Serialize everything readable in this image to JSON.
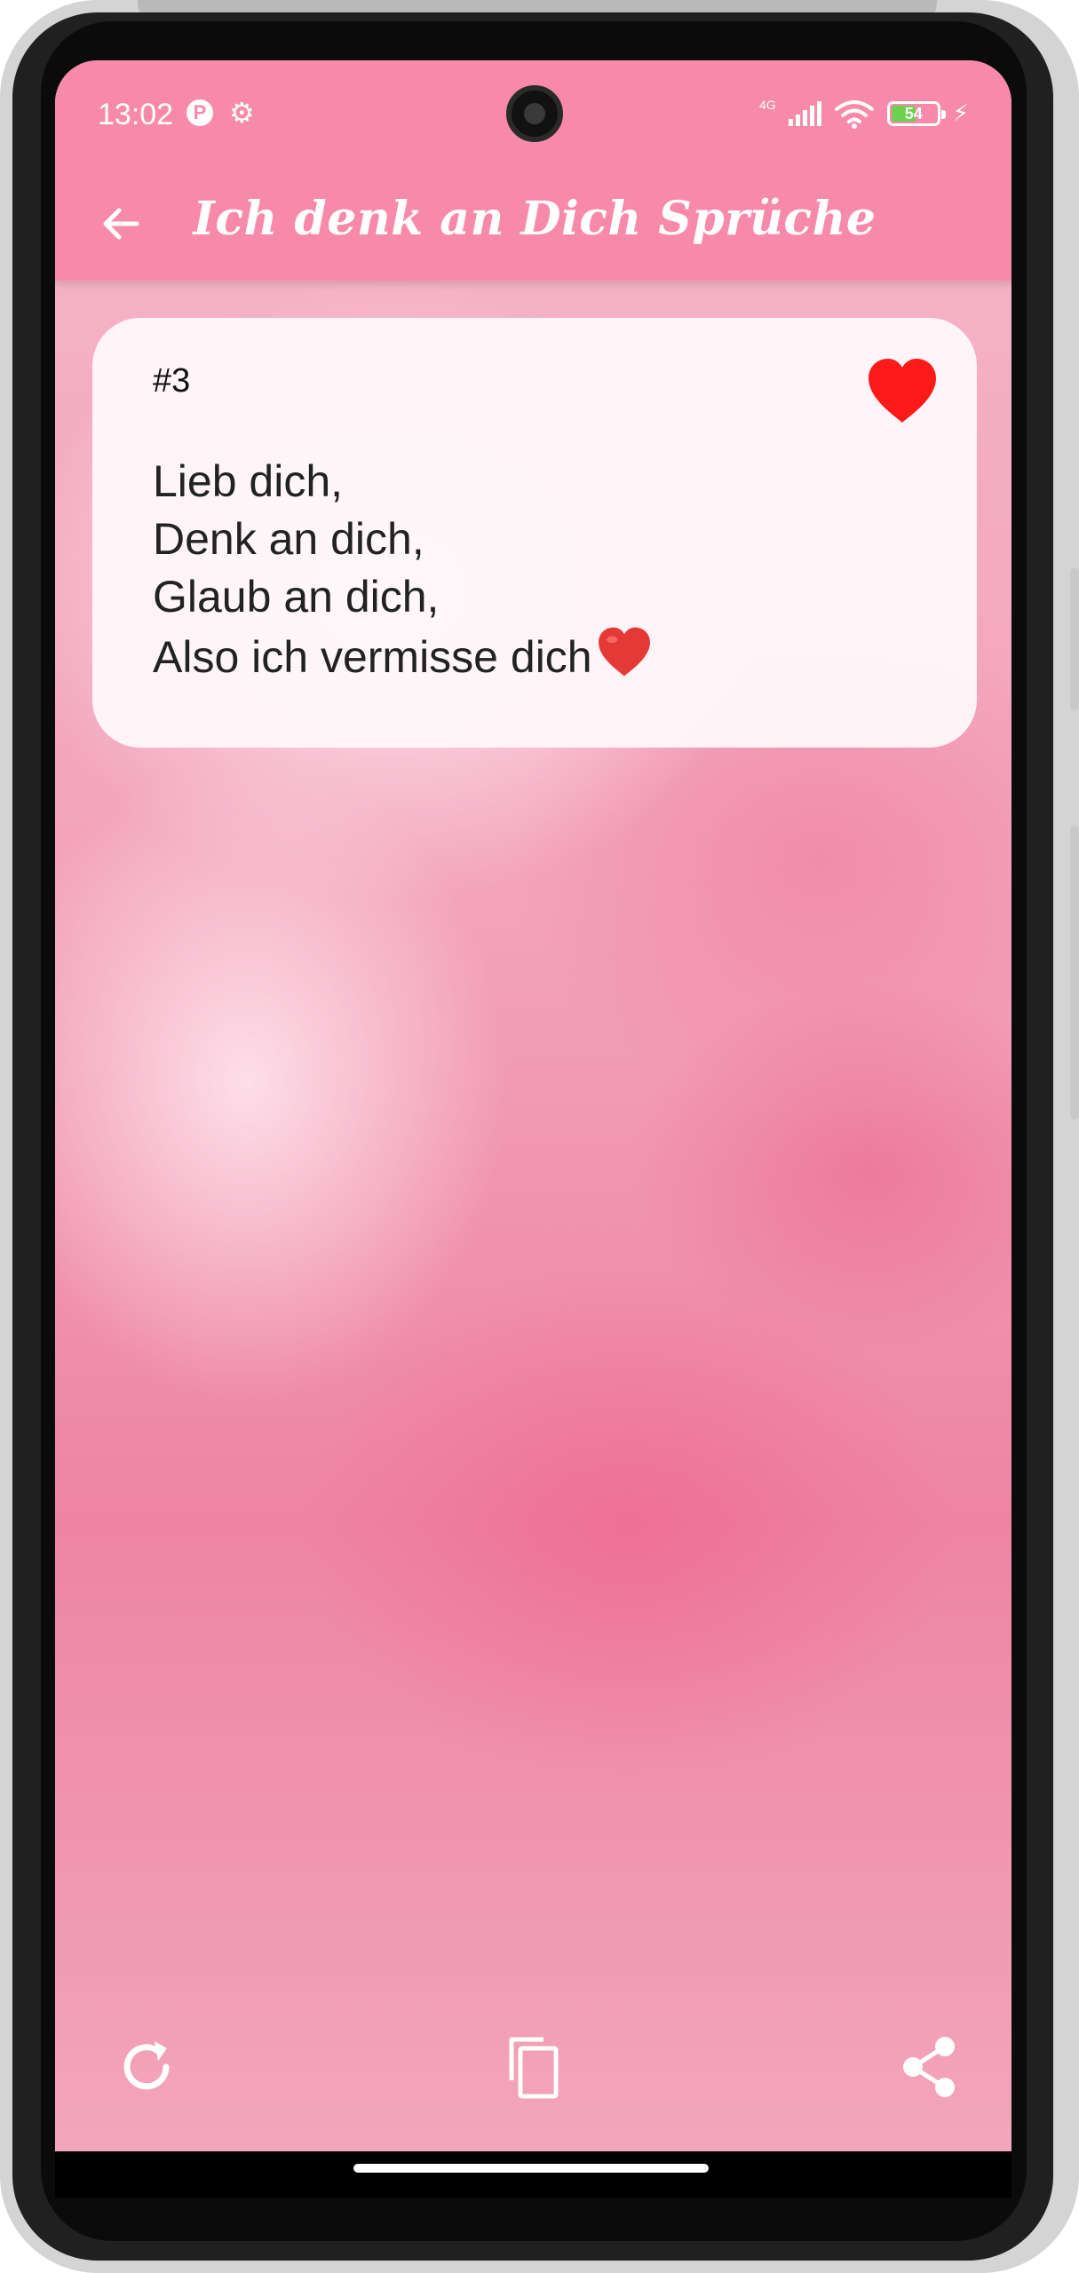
{
  "status_bar": {
    "time": "13:02",
    "network": "4G",
    "battery": "54",
    "battery_level": 0.54
  },
  "app_bar": {
    "title": "Ich denk an Dich Sprüche",
    "back_icon": "arrow-left-icon"
  },
  "quote": {
    "number": "#3",
    "lines": [
      "Lieb dich,",
      "Denk an dich,",
      "Glaub an dich,",
      "Also ich vermisse dich"
    ],
    "trailing_emoji": "red-heart-emoji",
    "favorite": true,
    "favorite_icon": "heart-icon"
  },
  "actions": {
    "refresh_icon": "refresh-icon",
    "copy_icon": "copy-icon",
    "share_icon": "share-icon"
  },
  "colors": {
    "app_bar": "#f78aab",
    "heart": "#ff1a1a",
    "background": "#f3a3bb"
  }
}
